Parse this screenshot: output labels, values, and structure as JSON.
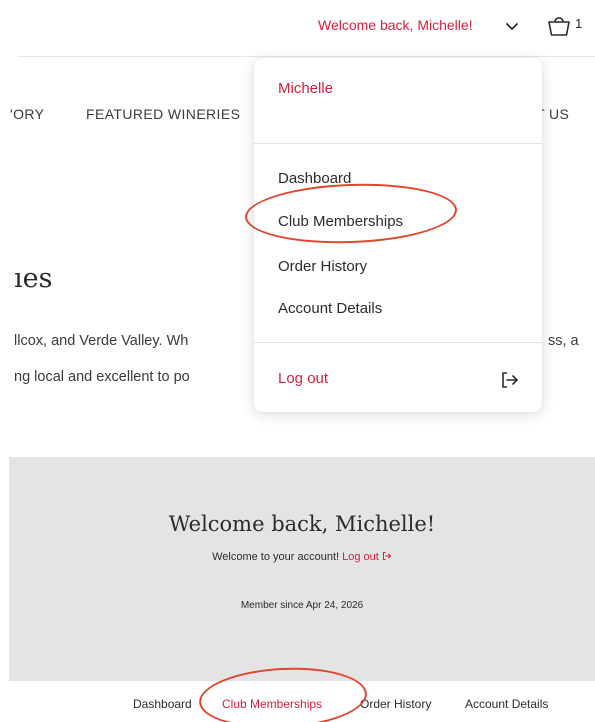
{
  "header": {
    "welcome_link": "Welcome back, Michelle!",
    "cart_count": "1"
  },
  "nav": {
    "history": "'ORY",
    "wineries": "FEATURED WINERIES",
    "about": "T US"
  },
  "content": {
    "heading": "ıes",
    "line1": "llcox, and Verde Valley. Wh",
    "line1_right": "ss, a",
    "line2": "ng local and excellent to po"
  },
  "dropdown": {
    "user_name": "Michelle",
    "items": [
      "Dashboard",
      "Club Memberships",
      "Order History",
      "Account Details"
    ],
    "logout": "Log out"
  },
  "banner": {
    "title": "Welcome back, Michelle!",
    "subtitle": "Welcome to your account!",
    "logout_link": "Log out",
    "member_since": "Member since Apr 24, 2026"
  },
  "tabs": [
    "Dashboard",
    "Club Memberships",
    "Order History",
    "Account Details"
  ],
  "colors": {
    "accent": "#d4203f",
    "annotation": "#e0452d",
    "banner_bg": "#e4e4e4"
  },
  "icons": [
    "chevron-down-icon",
    "shopping-bag-icon",
    "logout-icon"
  ]
}
